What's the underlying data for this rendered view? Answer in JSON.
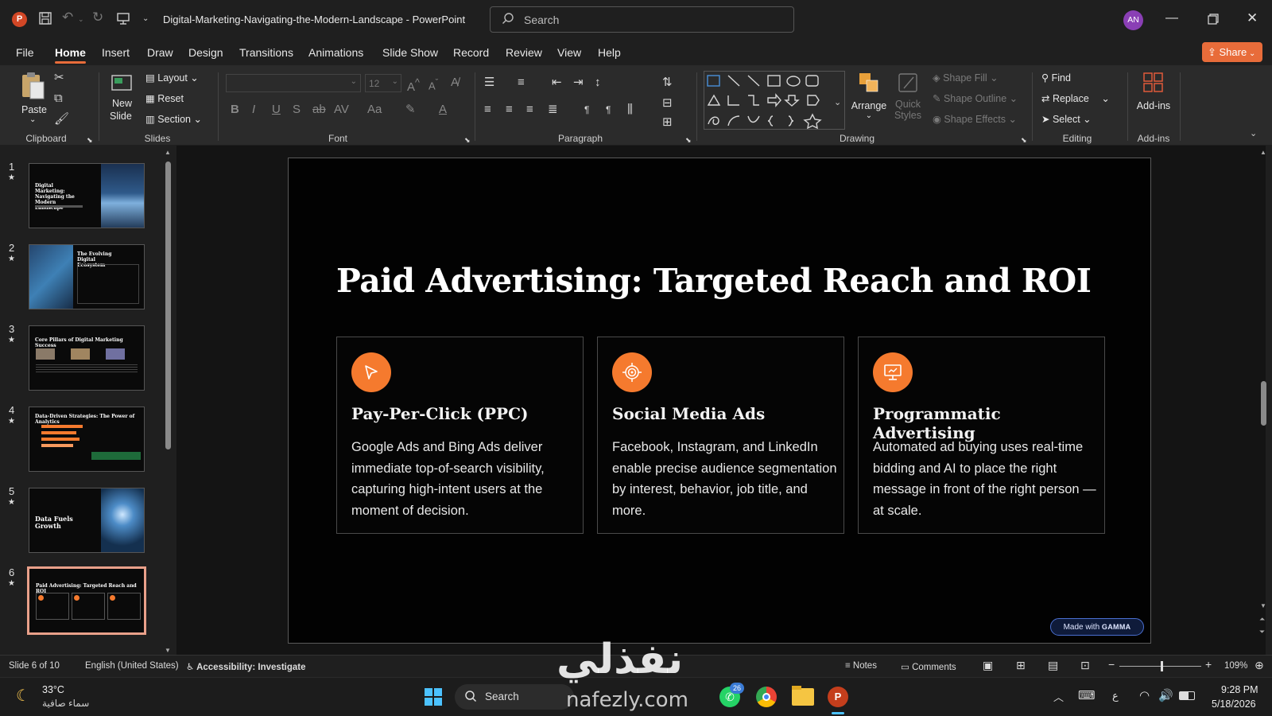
{
  "window": {
    "title": "Digital-Marketing-Navigating-the-Modern-Landscape - PowerPoint",
    "search_placeholder": "Search",
    "avatar": "AN",
    "share": "Share"
  },
  "menu": [
    "File",
    "Home",
    "Insert",
    "Draw",
    "Design",
    "Transitions",
    "Animations",
    "Slide Show",
    "Record",
    "Review",
    "View",
    "Help"
  ],
  "ribbon": {
    "paste": "Paste",
    "new_slide": "New",
    "new_slide2": "Slide",
    "layout": "Layout",
    "reset": "Reset",
    "section": "Section",
    "font_size": "12",
    "arrange": "Arrange",
    "quick_styles": "Quick",
    "quick_styles2": "Styles",
    "shape_fill": "Shape Fill",
    "shape_outline": "Shape Outline",
    "shape_effects": "Shape Effects",
    "find": "Find",
    "replace": "Replace",
    "select": "Select",
    "addins": "Add-ins",
    "groups": {
      "clipboard": "Clipboard",
      "slides": "Slides",
      "font": "Font",
      "paragraph": "Paragraph",
      "drawing": "Drawing",
      "editing": "Editing",
      "addins": "Add-ins"
    }
  },
  "thumbnails": [
    {
      "num": "1",
      "title": "Digital Marketing: Navigating the Modern Landscape"
    },
    {
      "num": "2",
      "title": "The Evolving Digital Ecosystem"
    },
    {
      "num": "3",
      "title": "Core Pillars of Digital Marketing Success"
    },
    {
      "num": "4",
      "title": "Data-Driven Strategies: The Power of Analytics"
    },
    {
      "num": "5",
      "title": "Data Fuels Growth"
    },
    {
      "num": "6",
      "title": "Paid Advertising: Targeted Reach and ROI"
    }
  ],
  "slide": {
    "title": "Paid Advertising: Targeted Reach and ROI",
    "cards": [
      {
        "icon": "cursor-arrow-icon",
        "title": "Pay-Per-Click (PPC)",
        "text": "Google Ads and Bing Ads deliver immediate top-of-search visibility, capturing high-intent users at the moment of decision."
      },
      {
        "icon": "target-icon",
        "title": "Social Media Ads",
        "text": "Facebook, Instagram, and LinkedIn enable precise audience segmentation by interest, behavior, job title, and more."
      },
      {
        "icon": "monitor-icon",
        "title": "Programmatic Advertising",
        "text": "Automated ad buying uses real-time bidding and AI to place the right message in front of the right person — at scale."
      }
    ],
    "badge_prefix": "Made with",
    "badge_brand": "GAMMA"
  },
  "status": {
    "slide_of": "Slide 6 of 10",
    "language": "English (United States)",
    "accessibility": "Accessibility: Investigate",
    "notes": "Notes",
    "comments": "Comments",
    "zoom": "109%"
  },
  "taskbar": {
    "temp": "33°C",
    "weather": "سماء صافية",
    "search": "Search",
    "badge": "26",
    "time": "9:28 PM",
    "date": "5/18/2026",
    "lang": "ع"
  },
  "watermark": {
    "arabic": "نفذلي",
    "latin": "nafezly.com"
  },
  "colors": {
    "accent": "#f57a2e",
    "ppt_red": "#c43e1c"
  }
}
